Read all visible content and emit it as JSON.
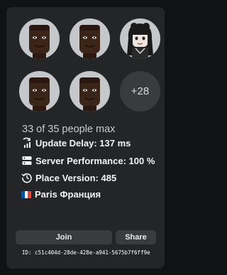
{
  "server": {
    "player_count": "33 of 35 people max",
    "more_avatars": "+28",
    "stats": {
      "update_delay": "Update Delay: 137 ms",
      "server_performance": "Server Performance: 100 %",
      "place_version": "Place Version: 485",
      "location": "Paris Франция"
    },
    "join_label": "Join",
    "share_label": "Share",
    "server_id": "ID: c51c404d-28de-428e-a941-5675b7f6ff9e"
  },
  "avatars": [
    {
      "kind": "man-face"
    },
    {
      "kind": "man-face"
    },
    {
      "kind": "girl-goth"
    },
    {
      "kind": "man-face"
    },
    {
      "kind": "man-face"
    }
  ],
  "colors": {
    "card_bg": "#232527",
    "page_bg": "#111214",
    "button_bg": "#393b3d",
    "avatar_bg": "#c5c7cb",
    "flag": [
      "#0055a4",
      "#ffffff",
      "#ef4135"
    ]
  }
}
